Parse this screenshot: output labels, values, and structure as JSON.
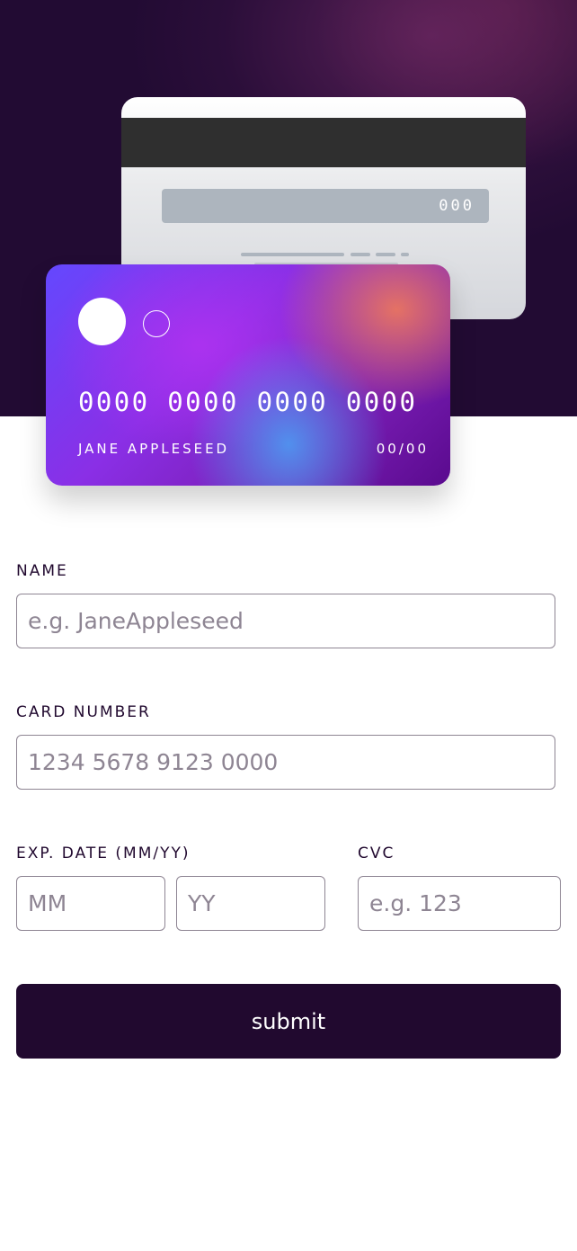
{
  "card_back": {
    "cvc": "000"
  },
  "card_front": {
    "number": "0000 0000 0000 0000",
    "holder": "JANE APPLESEED",
    "expiry": "00/00"
  },
  "form": {
    "name": {
      "label": "NAME",
      "placeholder": "e.g. JaneAppleseed"
    },
    "card_number": {
      "label": "CARD NUMBER",
      "placeholder": "1234 5678 9123 0000"
    },
    "exp_date": {
      "label": "EXP. DATE (MM/YY)",
      "month_placeholder": "MM",
      "year_placeholder": "YY"
    },
    "cvc": {
      "label": "CVC",
      "placeholder": "e.g. 123"
    },
    "submit_label": "submit"
  },
  "colors": {
    "dark_violet": "#21092f",
    "border_gray": "#8e8593",
    "white": "#ffffff"
  }
}
